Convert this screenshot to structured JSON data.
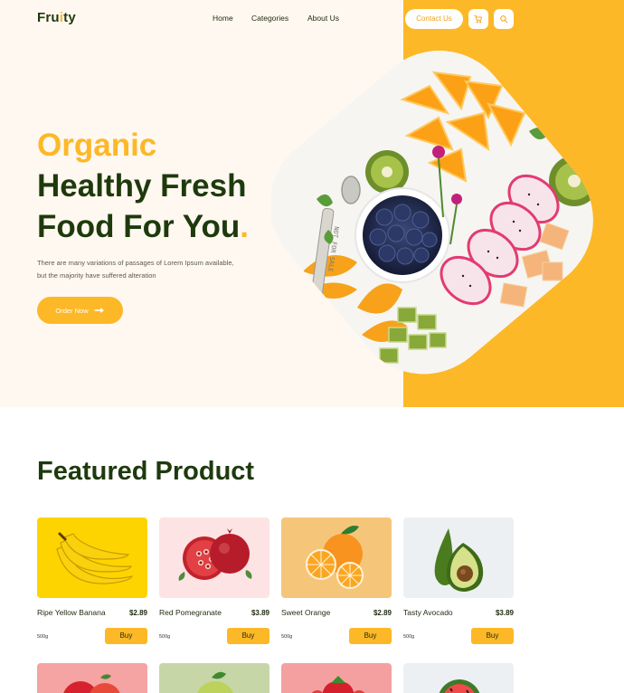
{
  "header": {
    "logo_prefix": "Fru",
    "logo_dot": "i",
    "logo_suffix": "ty",
    "nav": [
      "Home",
      "Categories",
      "About Us"
    ],
    "contact_label": "Contact Us",
    "cart_icon": "cart-icon",
    "search_icon": "search-icon"
  },
  "hero": {
    "title_line1": "Organic",
    "title_line2": "Healthy Fresh",
    "title_line3": "Food For You",
    "title_period": ".",
    "description": "There are many variations of passages of Lorem Ipsum available, but the majority have suffered alteration",
    "order_label": "Order Now",
    "spoon_text": "NOT FOR SALE"
  },
  "featured": {
    "title": "Featured Product",
    "products": [
      {
        "name": "Ripe Yellow Banana",
        "price": "$2.89",
        "weight": "500g",
        "buy": "Buy",
        "bg": "#fed400"
      },
      {
        "name": "Red Pomegranate",
        "price": "$3.89",
        "weight": "500g",
        "buy": "Buy",
        "bg": "#fde3e3"
      },
      {
        "name": "Sweet Orange",
        "price": "$2.89",
        "weight": "500g",
        "buy": "Buy",
        "bg": "#f5c67a"
      },
      {
        "name": "Tasty Avocado",
        "price": "$3.89",
        "weight": "500g",
        "buy": "Buy",
        "bg": "#edf0f3"
      }
    ],
    "row2_bgs": [
      "#f5a3a3",
      "#c7d6a6",
      "#f5a0a0",
      "#edf0f3"
    ]
  },
  "colors": {
    "accent": "#fdb827",
    "dark_green": "#1e3a0d",
    "cream": "#fff8f0"
  }
}
